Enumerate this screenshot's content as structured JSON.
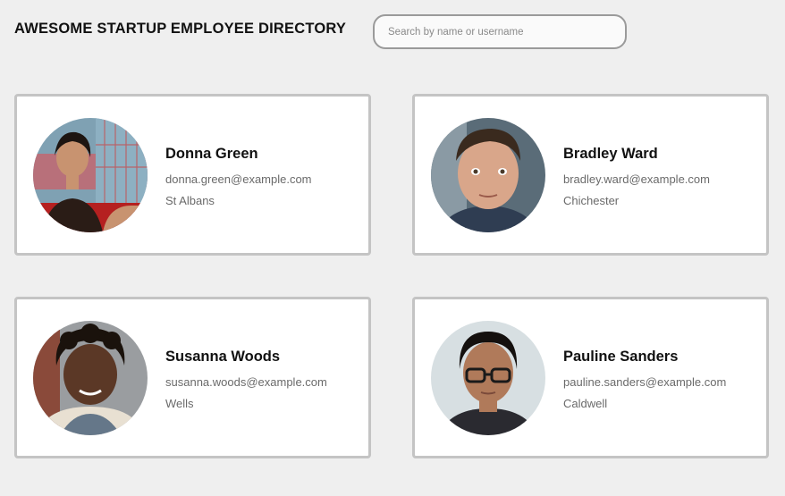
{
  "header": {
    "title": "AWESOME STARTUP EMPLOYEE DIRECTORY",
    "search_placeholder": "Search by name or username"
  },
  "employees": [
    {
      "name": "Donna Green",
      "email": "donna.green@example.com",
      "city": "St Albans",
      "avatar_icon": "person-photo-icon"
    },
    {
      "name": "Bradley Ward",
      "email": "bradley.ward@example.com",
      "city": "Chichester",
      "avatar_icon": "person-photo-icon"
    },
    {
      "name": "Susanna Woods",
      "email": "susanna.woods@example.com",
      "city": "Wells",
      "avatar_icon": "person-photo-icon"
    },
    {
      "name": "Pauline Sanders",
      "email": "pauline.sanders@example.com",
      "city": "Caldwell",
      "avatar_icon": "person-photo-icon"
    }
  ],
  "colors": {
    "page_background": "#efefef",
    "card_border": "#c4c4c4",
    "secondary_text": "#6a6a6a"
  }
}
